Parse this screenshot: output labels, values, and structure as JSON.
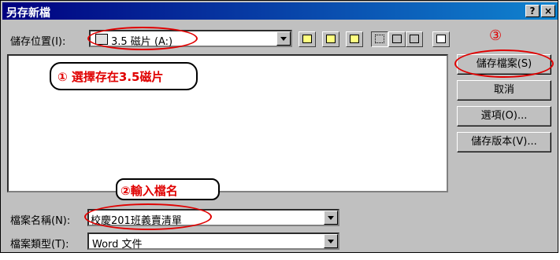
{
  "window": {
    "title": "另存新檔",
    "help_button": "?",
    "close_button": "×"
  },
  "save_in": {
    "label": "儲存位置(I):",
    "value": "3.5 磁片 (A:)"
  },
  "toolbar": {
    "icons": [
      "up-one-level-icon",
      "desktop-icon",
      "new-folder-icon",
      "list-view-icon",
      "details-view-icon",
      "properties-view-icon",
      "tools-icon"
    ]
  },
  "buttons": {
    "save": "儲存檔案(S)",
    "cancel": "取消",
    "options": "選項(O)...",
    "save_version": "儲存版本(V)..."
  },
  "filename": {
    "label": "檔案名稱(N):",
    "value": "校慶201班義賣清單"
  },
  "filetype": {
    "label": "檔案類型(T):",
    "value": "Word 文件"
  },
  "annotations": {
    "step1": "① 選擇存在3.5磁片",
    "step2": "②輸入檔名",
    "step3": "③",
    "color": "#e00000"
  }
}
